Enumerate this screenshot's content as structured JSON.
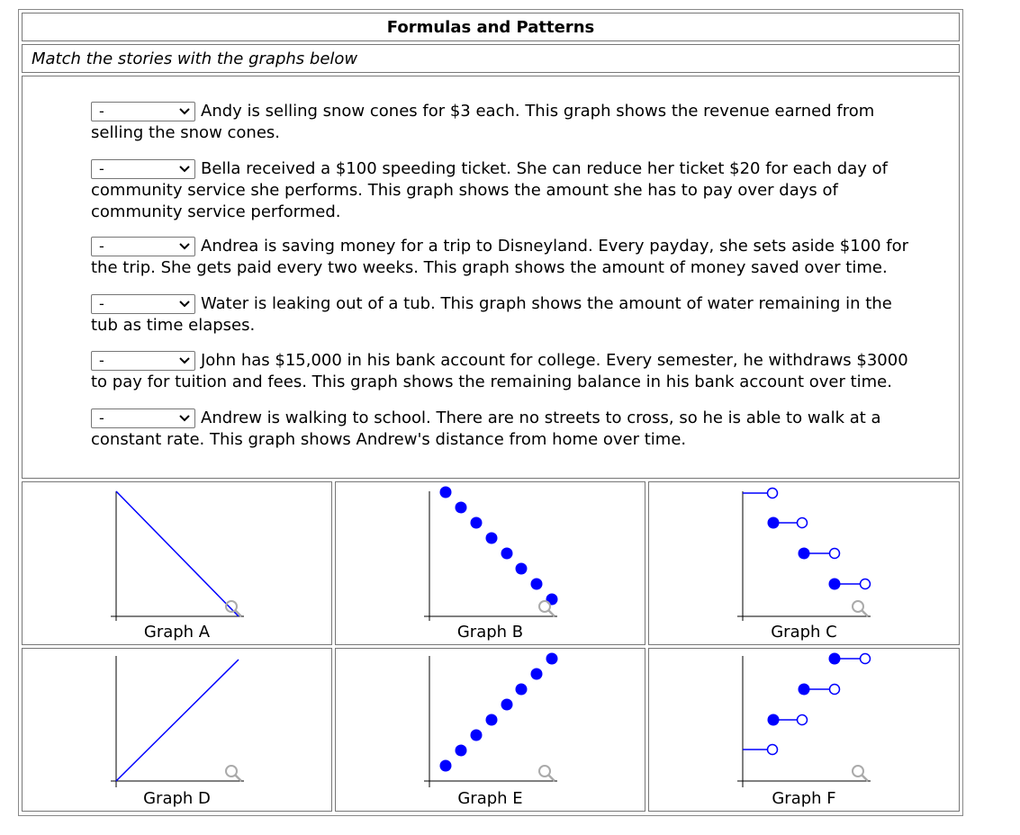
{
  "header": {
    "title": "Formulas and Patterns"
  },
  "instructions": "Match the stories with the graphs below",
  "stories": [
    {
      "selected": "-",
      "text": "Andy is selling snow cones for $3 each. This graph shows the revenue earned from selling the snow cones."
    },
    {
      "selected": "-",
      "text": "Bella received a $100 speeding ticket. She can reduce her ticket $20 for each day of community service she performs. This graph shows the amount she has to pay over days of community service performed."
    },
    {
      "selected": "-",
      "text": "Andrea is saving money for a trip to Disneyland. Every payday, she sets aside $100 for the trip. She gets paid every two weeks. This graph shows the amount of money saved over time."
    },
    {
      "selected": "-",
      "text": "Water is leaking out of a tub. This graph shows the amount of water remaining in the tub as time elapses."
    },
    {
      "selected": "-",
      "text": "John has $15,000 in his bank account for college. Every semester, he withdraws $3000 to pay for tuition and fees. This graph shows the remaining balance in his bank account over time."
    },
    {
      "selected": "-",
      "text": "Andrew is walking to school. There are no streets to cross, so he is able to walk at a constant rate. This graph shows Andrew's distance from home over time."
    }
  ],
  "graphs": [
    {
      "caption": "Graph A",
      "kind": "line-decreasing"
    },
    {
      "caption": "Graph B",
      "kind": "dots-decreasing"
    },
    {
      "caption": "Graph C",
      "kind": "steps-decreasing"
    },
    {
      "caption": "Graph D",
      "kind": "line-increasing"
    },
    {
      "caption": "Graph E",
      "kind": "dots-increasing"
    },
    {
      "caption": "Graph F",
      "kind": "steps-increasing"
    }
  ],
  "colors": {
    "accent": "#0000ff",
    "axis": "#000000",
    "zoom": "#aaaaaa"
  },
  "icons": {
    "dropdown": "chevron-down-icon",
    "zoom": "magnifier-icon"
  }
}
